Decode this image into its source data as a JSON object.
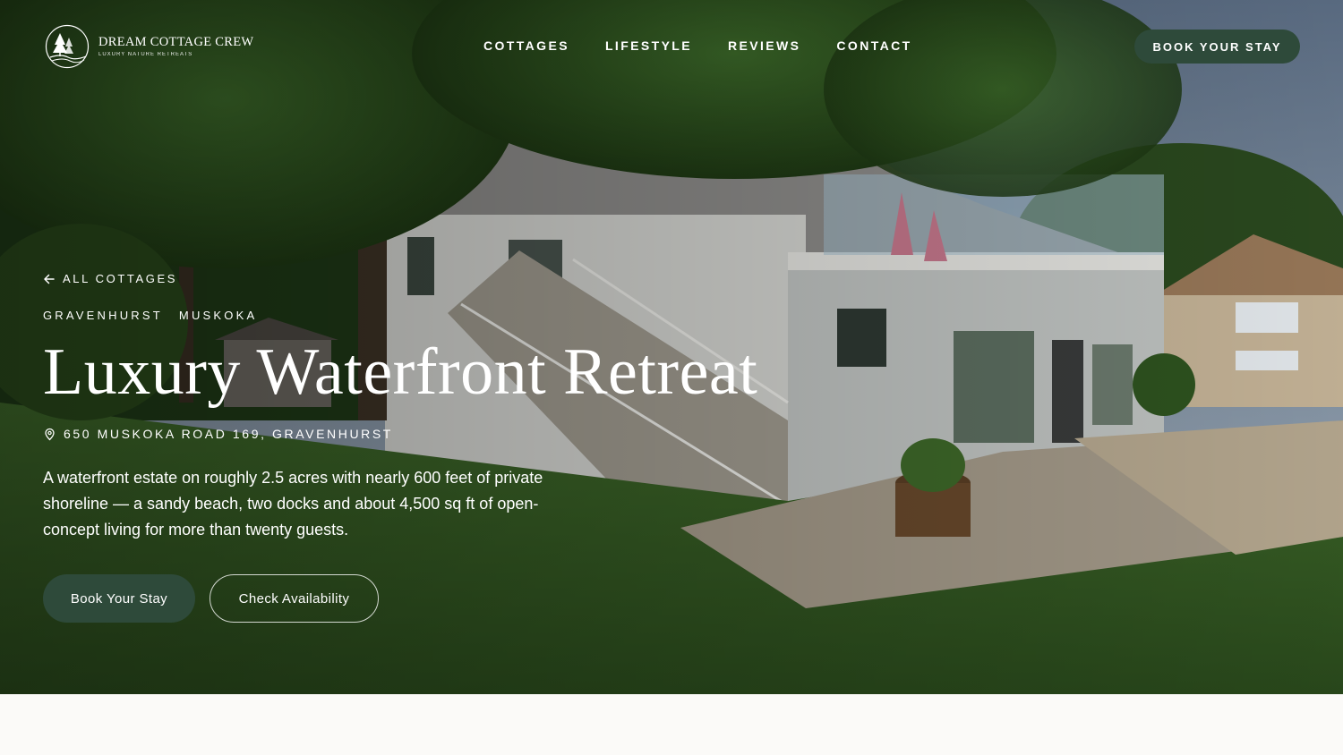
{
  "brand": {
    "name": "DREAM COTTAGE CREW",
    "tagline": "LUXURY NATURE RETREATS"
  },
  "nav": {
    "items": [
      {
        "label": "COTTAGES"
      },
      {
        "label": "LIFESTYLE"
      },
      {
        "label": "REVIEWS"
      },
      {
        "label": "CONTACT"
      }
    ],
    "cta_label": "BOOK YOUR STAY"
  },
  "hero": {
    "back_label": "ALL COTTAGES",
    "region": [
      "GRAVENHURST",
      "MUSKOKA"
    ],
    "title": "Luxury Waterfront Retreat",
    "address": "650 MUSKOKA ROAD 169, GRAVENHURST",
    "description": "A waterfront estate on roughly 2.5 acres with nearly 600 feet of private shoreline — a sandy beach, two docks and about 4,500 sq ft of open-concept living for more than twenty guests.",
    "primary_button": "Book Your Stay",
    "secondary_button": "Check Availability"
  },
  "icons": {
    "back": "arrow-left-icon",
    "location": "map-pin-icon",
    "logo": "tree-logo-icon"
  },
  "colors": {
    "accent": "#2e4a3a",
    "page_background": "#fbfaf8",
    "text_on_hero": "#ffffff"
  }
}
